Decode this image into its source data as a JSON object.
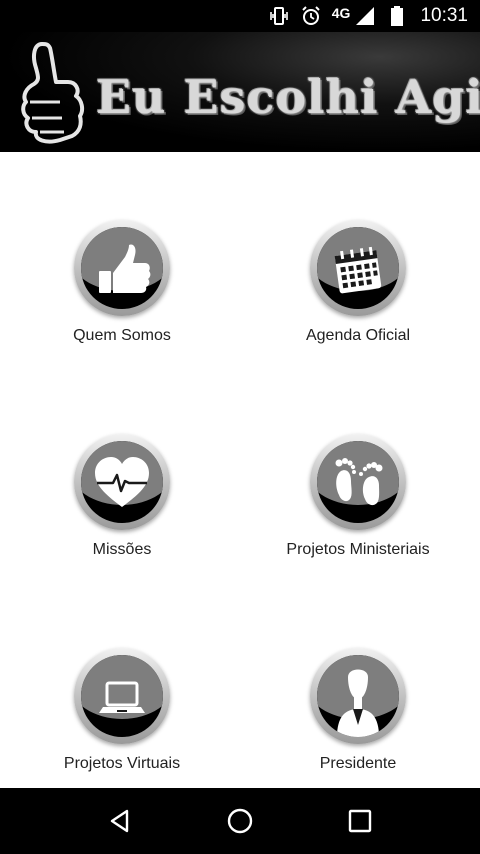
{
  "status_bar": {
    "network": "4G",
    "time": "10:31",
    "icons": [
      "vibrate-icon",
      "alarm-icon",
      "signal-icon",
      "battery-icon"
    ]
  },
  "header": {
    "brand_text": "Eu Escolhi Agir!",
    "logo_icon": "thumbs-up-icon"
  },
  "menu": {
    "items": [
      {
        "label": "Quem Somos",
        "icon": "thumbs-up-icon"
      },
      {
        "label": "Agenda Oficial",
        "icon": "calendar-icon"
      },
      {
        "label": "Missões",
        "icon": "heart-pulse-icon"
      },
      {
        "label": "Projetos Ministeriais",
        "icon": "footprints-icon"
      },
      {
        "label": "Projetos Virtuais",
        "icon": "laptop-icon"
      },
      {
        "label": "Presidente",
        "icon": "person-icon"
      }
    ]
  },
  "nav": {
    "icons": [
      "back-icon",
      "home-icon",
      "recents-icon"
    ]
  },
  "colors": {
    "background": "#ffffff",
    "bars": "#000000",
    "label_text": "#222222"
  }
}
